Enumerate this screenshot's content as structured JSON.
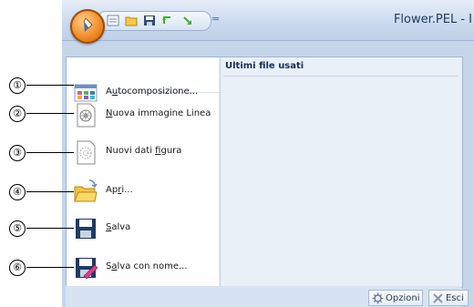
{
  "window": {
    "title": "Flower.PEL - I"
  },
  "quick_access_toolbar": {
    "icons": [
      "new-doc-icon",
      "open-folder-icon",
      "save-disk-icon",
      "undo-arrow-icon",
      "redo-arrow-icon"
    ],
    "separator_glyph": "="
  },
  "app_menu": {
    "recent_title": "Ultimi file usati",
    "items": [
      {
        "label": "Autocomposizione...",
        "key": "u",
        "icon": "wizard-icon",
        "callout": "①"
      },
      {
        "label": "Nuova immagine Linea",
        "key": "N",
        "icon": "line-image-icon",
        "callout": "②"
      },
      {
        "label": "Nuovi dati figura",
        "key": "f",
        "icon": "figure-data-icon",
        "callout": "③"
      },
      {
        "label": "Apri...",
        "key": "r",
        "icon": "open-folder-icon",
        "callout": "④"
      },
      {
        "label": "Salva",
        "key": "S",
        "icon": "save-icon",
        "callout": "⑤"
      },
      {
        "label": "Salva con nome...",
        "key": "a",
        "icon": "save-as-icon",
        "callout": "⑥"
      }
    ]
  },
  "bottom_buttons": {
    "options_label": "Opzioni",
    "exit_label": "Esci"
  },
  "colors": {
    "title_text": "#1e395b",
    "orb": "#f08a24",
    "frame": "#c5d6ea"
  }
}
